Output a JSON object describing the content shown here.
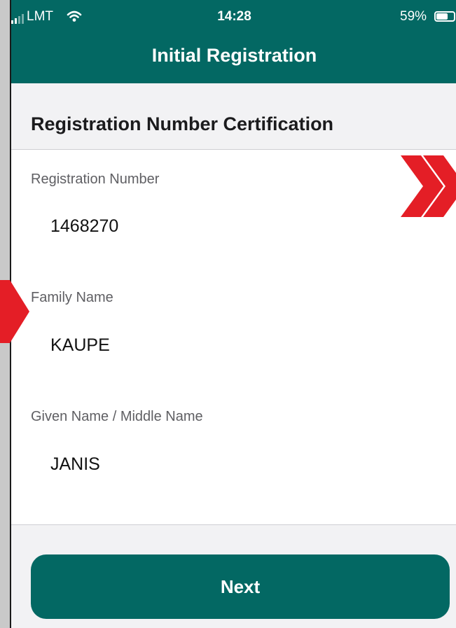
{
  "status_bar": {
    "carrier": "LMT",
    "time": "14:28",
    "battery": "59%",
    "battery_level": 0.59,
    "icons": [
      "signal-icon",
      "wifi-icon",
      "battery-icon"
    ]
  },
  "header": {
    "title": "Initial Registration"
  },
  "section": {
    "title": "Registration Number Certification"
  },
  "fields": [
    {
      "label": "Registration Number",
      "value": "1468270"
    },
    {
      "label": "Family Name",
      "value": "KAUPE"
    },
    {
      "label": "Given Name / Middle Name",
      "value": "JANIS"
    }
  ],
  "actions": {
    "next_label": "Next"
  },
  "colors": {
    "brand": "#036863",
    "background": "#f2f2f4",
    "annotation_red": "#e41e26"
  },
  "annotations": [
    "double-chevron-icon",
    "chevron-right-icon"
  ]
}
